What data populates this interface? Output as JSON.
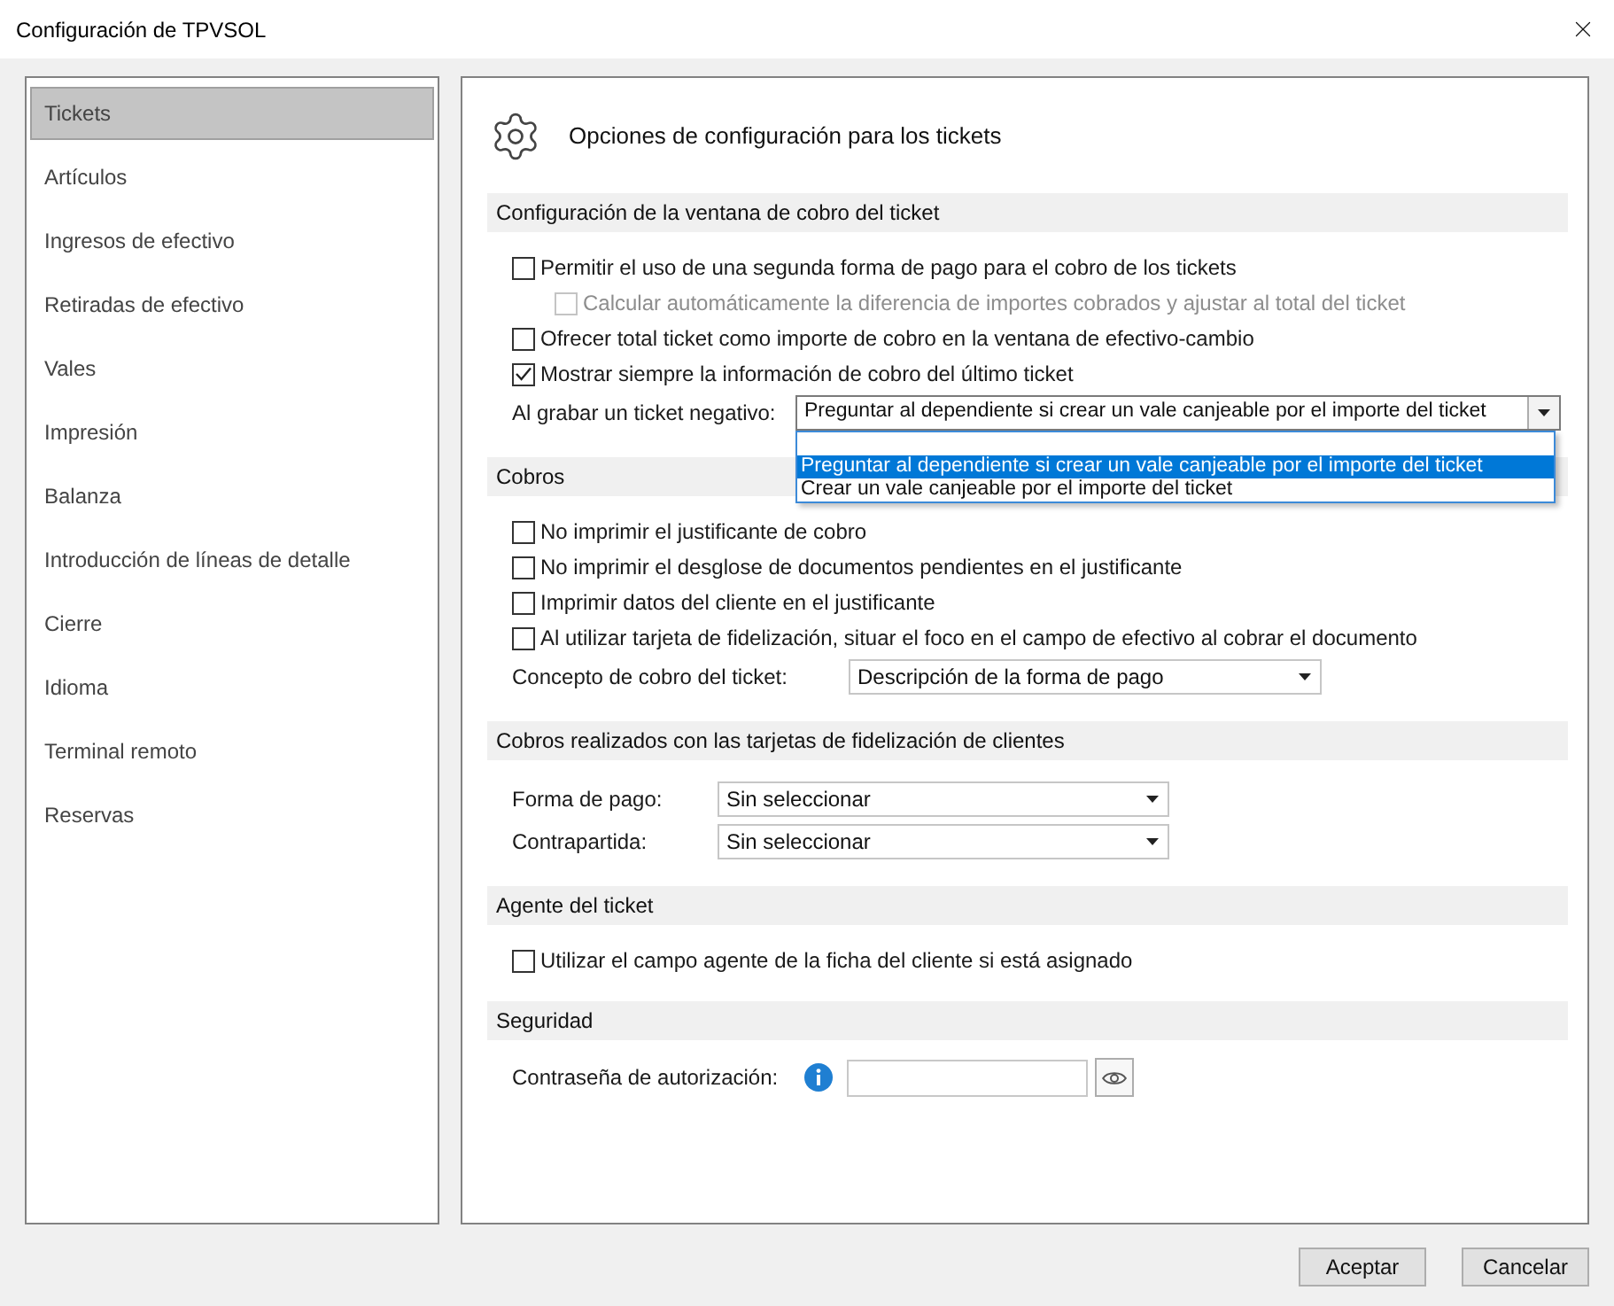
{
  "window": {
    "title": "Configuración de TPVSOL"
  },
  "sidebar": {
    "items": [
      {
        "label": "Tickets",
        "selected": true
      },
      {
        "label": "Artículos",
        "selected": false
      },
      {
        "label": "Ingresos de efectivo",
        "selected": false
      },
      {
        "label": "Retiradas de efectivo",
        "selected": false
      },
      {
        "label": "Vales",
        "selected": false
      },
      {
        "label": "Impresión",
        "selected": false
      },
      {
        "label": "Balanza",
        "selected": false
      },
      {
        "label": "Introducción de líneas de detalle",
        "selected": false
      },
      {
        "label": "Cierre",
        "selected": false
      },
      {
        "label": "Idioma",
        "selected": false
      },
      {
        "label": "Terminal remoto",
        "selected": false
      },
      {
        "label": "Reservas",
        "selected": false
      }
    ]
  },
  "main": {
    "title": "Opciones de configuración para los tickets"
  },
  "sections": [
    {
      "title": "Configuración de la ventana de cobro del ticket",
      "rows": [
        {
          "kind": "checkbox",
          "label": "Permitir el uso de una segunda forma de pago para el cobro de los tickets",
          "checked": false,
          "disabled": false,
          "children": [
            {
              "kind": "checkbox",
              "label": "Calcular automáticamente la diferencia de importes cobrados y ajustar al total del ticket",
              "checked": false,
              "disabled": true
            }
          ]
        },
        {
          "kind": "checkbox",
          "label": "Ofrecer total ticket como importe de cobro en la ventana de efectivo-cambio",
          "checked": false,
          "disabled": false
        },
        {
          "kind": "checkbox",
          "label": "Mostrar siempre la información de cobro del último ticket",
          "checked": true,
          "disabled": false
        },
        {
          "kind": "combo",
          "label": "Al grabar un ticket negativo:",
          "value": "Preguntar al dependiente si crear un vale canjeable por el importe del ticket",
          "expanded": true,
          "options": [
            {
              "label": "Preguntar al dependiente si crear un vale canjeable por el importe del ticket",
              "selected": true
            },
            {
              "label": "Crear un vale canjeable por el importe del ticket",
              "selected": false
            }
          ]
        }
      ]
    },
    {
      "title": "Cobros",
      "rows": [
        {
          "kind": "checkbox",
          "label": "No imprimir el justificante de cobro",
          "checked": false,
          "disabled": false
        },
        {
          "kind": "checkbox",
          "label": "No imprimir el desglose de documentos pendientes en el justificante",
          "checked": false,
          "disabled": false
        },
        {
          "kind": "checkbox",
          "label": "Imprimir datos del cliente en el justificante",
          "checked": false,
          "disabled": false
        },
        {
          "kind": "checkbox",
          "label": "Al utilizar tarjeta de fidelización, situar el foco en el campo de efectivo al cobrar el documento",
          "checked": false,
          "disabled": false
        },
        {
          "kind": "combo",
          "label": "Concepto de cobro del ticket:",
          "value": "Descripción de la forma de pago",
          "expanded": false
        }
      ]
    },
    {
      "title": "Cobros realizados con las tarjetas de fidelización de clientes",
      "rows": [
        {
          "kind": "combo",
          "label": "Forma de pago:",
          "value": "Sin seleccionar",
          "expanded": false
        },
        {
          "kind": "combo",
          "label": "Contrapartida:",
          "value": "Sin seleccionar",
          "expanded": false
        }
      ]
    },
    {
      "title": "Agente del ticket",
      "rows": [
        {
          "kind": "checkbox",
          "label": "Utilizar el campo agente de la ficha del cliente si está asignado",
          "checked": false,
          "disabled": false
        }
      ]
    },
    {
      "title": "Seguridad",
      "rows": [
        {
          "kind": "password",
          "label": "Contraseña de autorización:"
        }
      ]
    }
  ],
  "buttons": [
    "Aceptar",
    "Cancelar"
  ]
}
